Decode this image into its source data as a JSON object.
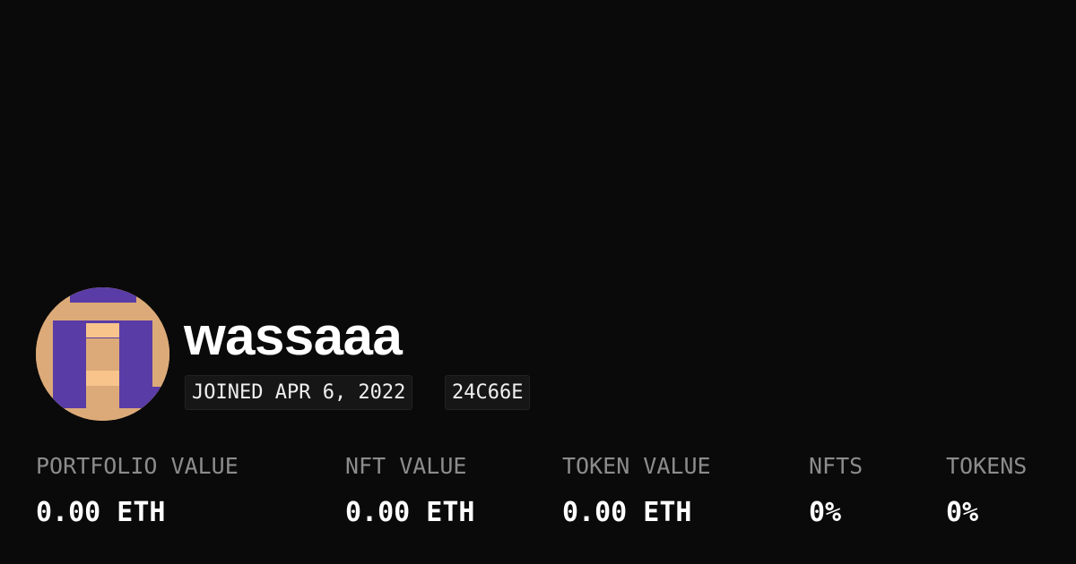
{
  "profile": {
    "username": "wassaaa",
    "joined": "JOINED APR 6, 2022",
    "address_short": "24C66E",
    "avatar_icon": "pixel-avatar-icon",
    "avatar_colors": {
      "background": "#dcaa78",
      "primary": "#5a3ca6",
      "highlight": "#f8c48c"
    }
  },
  "stats": [
    {
      "label": "PORTFOLIO VALUE",
      "value": "0.00 ETH"
    },
    {
      "label": "NFT VALUE",
      "value": "0.00 ETH"
    },
    {
      "label": "TOKEN VALUE",
      "value": "0.00 ETH"
    },
    {
      "label": "NFTS",
      "value": "0%"
    },
    {
      "label": "TOKENS",
      "value": "0%"
    }
  ],
  "colors": {
    "background": "#0a0a0a",
    "label": "#8c8c8c",
    "text": "#ffffff"
  }
}
